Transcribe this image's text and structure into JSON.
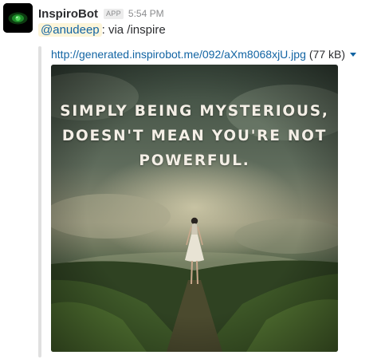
{
  "message": {
    "sender": "InspiroBot",
    "app_badge": "APP",
    "time": "5:54 PM",
    "mention": "@anudeep",
    "text": ": via /inspire"
  },
  "attachment": {
    "link": "http://generated.inspirobot.me/092/aXm8068xjU.jpg",
    "size": "(77 kB)"
  },
  "image": {
    "quote_lines": [
      "SIMPLY BEING MYSTERIOUS,",
      "DOESN'T MEAN YOU'RE NOT",
      "POWERFUL."
    ]
  },
  "icons": {
    "avatar": "inspirobot-avatar",
    "dropdown": "chevron-down-icon"
  },
  "colors": {
    "link": "#1264a3",
    "mention_bg": "#fdf5d9"
  }
}
